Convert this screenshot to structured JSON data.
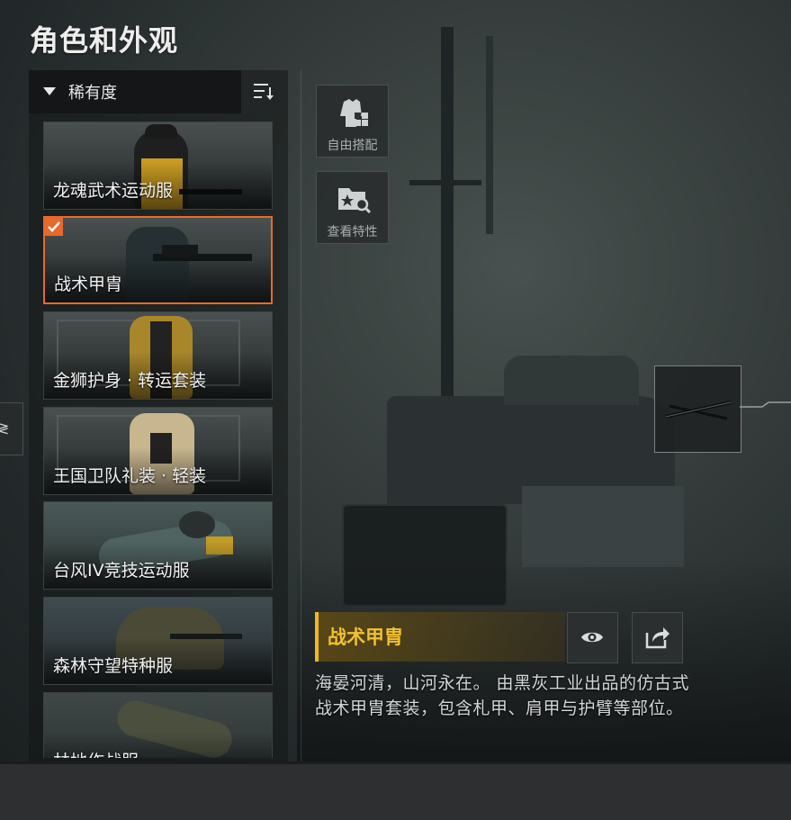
{
  "page_title": "角色和外观",
  "sort": {
    "label": "稀有度",
    "button_icon": "sort-list-icon"
  },
  "outfits": [
    {
      "name": "龙魂武术运动服",
      "selected": false
    },
    {
      "name": "战术甲胄",
      "selected": true
    },
    {
      "name": "金狮护身 · 转运套装",
      "selected": false
    },
    {
      "name": "王国卫队礼装 · 轻装",
      "selected": false
    },
    {
      "name": "台风IV竞技运动服",
      "selected": false
    },
    {
      "name": "森林守望特种服",
      "selected": false
    },
    {
      "name": "林地作战服",
      "selected": false
    }
  ],
  "side_buttons": {
    "free_match": {
      "label": "自由搭配",
      "icon": "outfit-mix-icon"
    },
    "view_traits": {
      "label": "查看特性",
      "icon": "trait-search-icon"
    }
  },
  "left_stub_glyph": "≷",
  "detail": {
    "name": "战术甲胄",
    "description": "海晏河清，山河永在。 由黑灰工业出品的仿古式战术甲胄套装，包含札甲、肩甲与护臂等部位。",
    "preview_icon": "eye-icon",
    "share_icon": "share-icon"
  },
  "colors": {
    "accent_orange": "#e8692c",
    "gold": "#f2c12e"
  }
}
